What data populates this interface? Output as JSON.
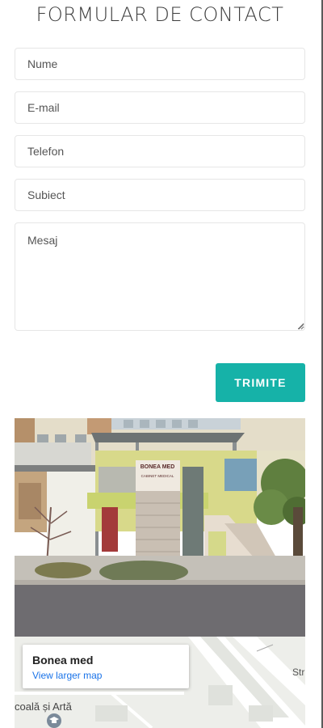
{
  "form": {
    "title": "FORMULAR DE CONTACT",
    "fields": {
      "name_placeholder": "Nume",
      "email_placeholder": "E-mail",
      "phone_placeholder": "Telefon",
      "subject_placeholder": "Subiect",
      "message_placeholder": "Mesaj"
    },
    "submit_label": "TRIMITE",
    "accent_color": "#16b2a8"
  },
  "photo": {
    "sign_name": "BONEA MED",
    "sign_subtitle": "CABINET MEDICAL"
  },
  "map": {
    "place_name": "Bonea med",
    "larger_map_link": "View larger map",
    "label_school": "coală și Artă",
    "label_street": "Str",
    "poi_icon": "school-icon"
  }
}
